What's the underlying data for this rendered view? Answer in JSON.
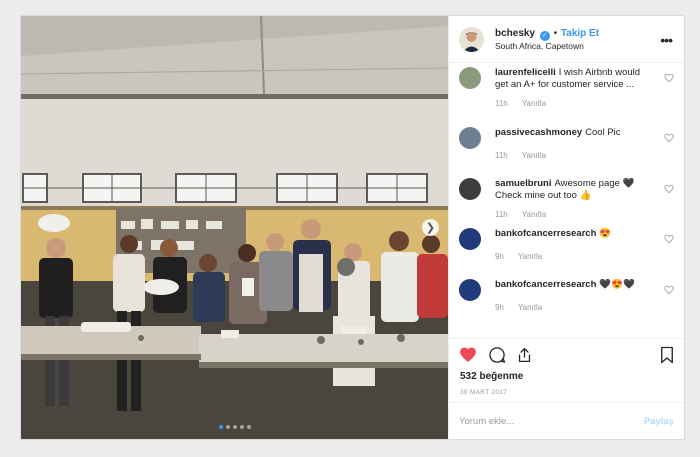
{
  "post": {
    "dot_count": 5,
    "active_dot": 0
  },
  "header": {
    "username": "bchesky",
    "separator": "•",
    "follow_label": "Takip Et",
    "location": "South Africa, Capetown",
    "more_label": "•••"
  },
  "comments": [
    {
      "username": "laurenfelicelli",
      "text": "I wish Airbnb would get an A+ for customer service ...",
      "time": "11h",
      "reply_label": "Yanıtla",
      "avatar_color": "#8a9a7a"
    },
    {
      "username": "passivecashmoney",
      "text": "Cool Pic",
      "time": "11h",
      "reply_label": "Yanıtla",
      "avatar_color": "#6c7f93"
    },
    {
      "username": "samuelbruni",
      "text": "Awesome page 🖤 Check mine out too 👍",
      "time": "11h",
      "reply_label": "Yanıtla",
      "avatar_color": "#3d3d3d"
    },
    {
      "username": "bankofcancerresearch",
      "text": "😍",
      "time": "9h",
      "reply_label": "Yanıtla",
      "avatar_color": "#1f3b7a"
    },
    {
      "username": "bankofcancerresearch",
      "text": "🖤😍🖤",
      "time": "9h",
      "reply_label": "Yanıtla",
      "avatar_color": "#1f3b7a"
    }
  ],
  "actions": {
    "likes": "532 beğenme",
    "date": "30 MART 2017"
  },
  "add_comment": {
    "placeholder": "Yorum ekle...",
    "post_label": "Paylaş"
  },
  "colors": {
    "accent": "#3897f0",
    "like_red": "#ed4956",
    "text": "#262626",
    "muted": "#999999"
  }
}
